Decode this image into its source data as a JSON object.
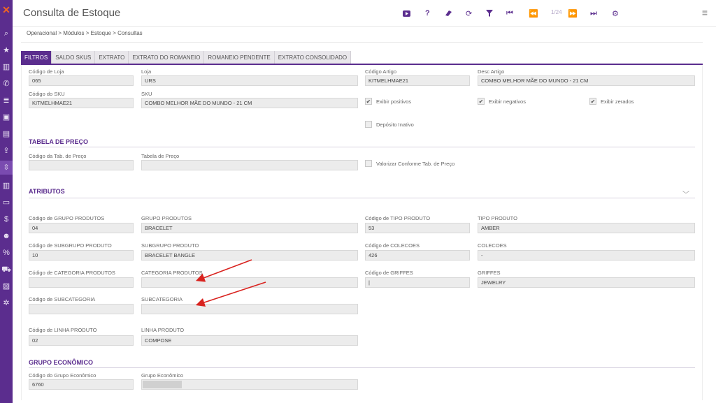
{
  "header": {
    "title": "Consulta de Estoque",
    "pager": "1/24",
    "accent": "#5b2d8e"
  },
  "breadcrumb": "Operacional > Módulos > Estoque > Consultas",
  "tabs": [
    {
      "label": "FILTROS",
      "active": true
    },
    {
      "label": "SALDO SKUS"
    },
    {
      "label": "EXTRATO"
    },
    {
      "label": "EXTRATO DO ROMANEIO"
    },
    {
      "label": "ROMANEIO PENDENTE"
    },
    {
      "label": "EXTRATO CONSOLIDADO"
    }
  ],
  "filtros": {
    "codigo_loja": {
      "label": "Código de Loja",
      "value": "065"
    },
    "loja": {
      "label": "Loja",
      "value": "URS"
    },
    "codigo_artigo": {
      "label": "Código Artigo",
      "value": "KITMELHMAE21"
    },
    "desc_artigo": {
      "label": "Desc Artigo",
      "value": "COMBO MELHOR MÃE DO MUNDO - 21 CM"
    },
    "codigo_sku": {
      "label": "Código do SKU",
      "value": "KITMELHMAE21"
    },
    "sku": {
      "label": "SKU",
      "value": "COMBO MELHOR MÃE DO MUNDO - 21 CM"
    },
    "exibir_positivos": {
      "label": "Exibir positivos",
      "checked": true
    },
    "exibir_negativos": {
      "label": "Exibir negativos",
      "checked": true
    },
    "exibir_zerados": {
      "label": "Exibir zerados",
      "checked": true
    },
    "deposito_inativo": {
      "label": "Depósito Inativo",
      "checked": false
    }
  },
  "tabela_preco": {
    "title": "TABELA DE PREÇO",
    "codigo_tab": {
      "label": "Código da Tab. de Preço",
      "value": ""
    },
    "tabela": {
      "label": "Tabela de Preço",
      "value": ""
    },
    "valorizar": {
      "label": "Valorizar Conforme Tab. de Preço",
      "checked": false
    }
  },
  "atributos": {
    "title": "ATRIBUTOS",
    "cod_grupo": {
      "label": "Código de GRUPO PRODUTOS",
      "value": "04"
    },
    "grupo": {
      "label": "GRUPO PRODUTOS",
      "value": "BRACELET"
    },
    "cod_tipo": {
      "label": "Código de TIPO PRODUTO",
      "value": "53"
    },
    "tipo": {
      "label": "TIPO PRODUTO",
      "value": "AMBER"
    },
    "cod_subgrupo": {
      "label": "Código de SUBGRUPO PRODUTO",
      "value": "10"
    },
    "subgrupo": {
      "label": "SUBGRUPO PRODUTO",
      "value": "BRACELET BANGLE"
    },
    "cod_colecoes": {
      "label": "Código de COLECOES",
      "value": "426"
    },
    "colecoes": {
      "label": "COLECOES",
      "value": "-"
    },
    "cod_categoria": {
      "label": "Código de CATEGORIA PRODUTOS",
      "value": ""
    },
    "categoria": {
      "label": "CATEGORIA PRODUTOS",
      "value": ""
    },
    "cod_griffes": {
      "label": "Código de GRIFFES",
      "value": "|"
    },
    "griffes": {
      "label": "GRIFFES",
      "value": "JEWELRY"
    },
    "cod_subcategoria": {
      "label": "Código de SUBCATEGORIA",
      "value": ""
    },
    "subcategoria": {
      "label": "SUBCATEGORIA",
      "value": ""
    },
    "cod_linha": {
      "label": "Código de LINHA PRODUTO",
      "value": "02"
    },
    "linha": {
      "label": "LINHA PRODUTO",
      "value": "COMPOSE"
    }
  },
  "grupo_economico": {
    "title": "GRUPO ECONÔMICO",
    "codigo": {
      "label": "Código do Grupo Econômico",
      "value": "6760"
    },
    "grupo": {
      "label": "Grupo Econômico",
      "value": ""
    }
  }
}
